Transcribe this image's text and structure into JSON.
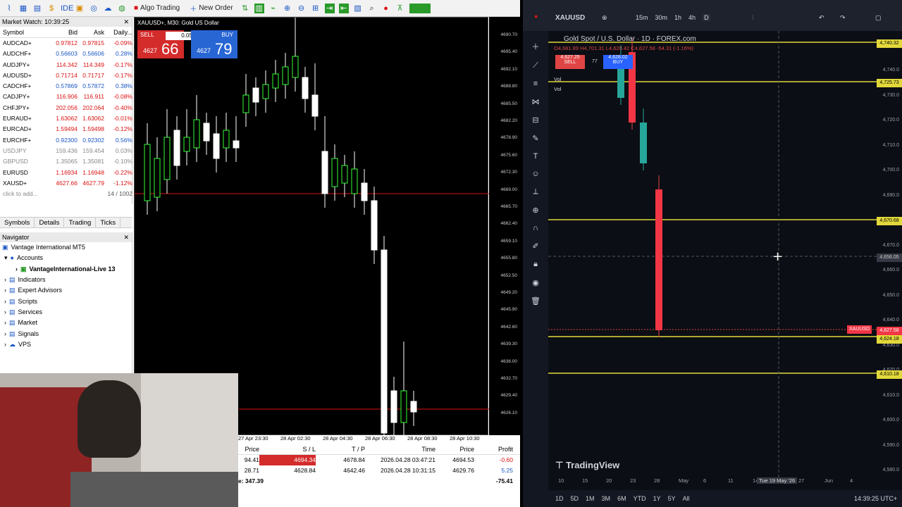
{
  "toolbar": {
    "algo_trading": "Algo Trading",
    "new_order": "New Order"
  },
  "market_watch": {
    "title": "Market Watch: 10:39:25",
    "headers": [
      "Symbol",
      "Bid",
      "Ask",
      "Daily..."
    ],
    "rows": [
      [
        "AUDCAD+",
        "0.97812",
        "0.97815",
        "-0.09%"
      ],
      [
        "AUDCHF+",
        "0.56603",
        "0.56606",
        "0.28%"
      ],
      [
        "AUDJPY+",
        "114.342",
        "114.349",
        "-0.17%"
      ],
      [
        "AUDUSD+",
        "0.71714",
        "0.71717",
        "-0.17%"
      ],
      [
        "CADCHF+",
        "0.57869",
        "0.57872",
        "0.38%"
      ],
      [
        "CADJPY+",
        "116.906",
        "116.911",
        "-0.08%"
      ],
      [
        "CHFJPY+",
        "202.056",
        "202.064",
        "-0.40%"
      ],
      [
        "EURAUD+",
        "1.63062",
        "1.63062",
        "-0.01%"
      ],
      [
        "EURCAD+",
        "1.59494",
        "1.59498",
        "-0.12%"
      ],
      [
        "EURCHF+",
        "0.92300",
        "0.92302",
        "0.56%"
      ],
      [
        "USDJPY",
        "159.436",
        "159.454",
        "0.03%"
      ],
      [
        "GBPUSD",
        "1.35065",
        "1.35081",
        "-0.10%"
      ],
      [
        "EURUSD",
        "1.16934",
        "1.16948",
        "-0.22%"
      ],
      [
        "XAUSD+",
        "4627.66",
        "4627.79",
        "-1.12%"
      ]
    ],
    "add_hint": "click to add...",
    "count": "14 / 1002",
    "tabs": [
      "Symbols",
      "Details",
      "Trading",
      "Ticks"
    ]
  },
  "navigator": {
    "title": "Navigator",
    "items": [
      "Vantage International MT5",
      "Accounts",
      "VantageInternational-Live 13",
      "Indicators",
      "Expert Advisors",
      "Scripts",
      "Services",
      "Market",
      "Signals",
      "VPS"
    ]
  },
  "chart": {
    "title": "XAUUSD+, M30: Gold US Dollar",
    "sell_label": "SELL",
    "buy_label": "BUY",
    "lot": "0.05",
    "sell_price_small": "4627",
    "sell_price_big": "66",
    "buy_price_small": "4627",
    "buy_price_big": "79",
    "yticks": [
      "4690.70",
      "4695.40",
      "4692.10",
      "4688.80",
      "4685.50",
      "4682.20",
      "4678.90",
      "4675.60",
      "4672.30",
      "4669.00",
      "4665.70",
      "4662.40",
      "4659.10",
      "4655.80",
      "4652.50",
      "4649.20",
      "4645.90",
      "4642.60",
      "4639.30",
      "4636.00",
      "4632.70",
      "4629.40",
      "4626.10"
    ],
    "xticks": [
      "27 Apr 23:30",
      "28 Apr 02:30",
      "28 Apr 04:30",
      "28 Apr 06:30",
      "28 Apr 08:30",
      "28 Apr 10:30"
    ]
  },
  "orders": {
    "headers": [
      "Price",
      "S / L",
      "T / P",
      "Time",
      "Price",
      "Profit"
    ],
    "rows": [
      [
        "94.41",
        "4694.34",
        "4678.84",
        "2026.04.28 03:47:21",
        "4694.53",
        "-0.60"
      ],
      [
        "28.71",
        "4628.84",
        "4642.46",
        "2026.04.28 10:31:15",
        "4629.76",
        "5.25"
      ]
    ],
    "balance": "e: 347.39",
    "total": "-75.41"
  },
  "tradingview": {
    "symbol": "XAUUSD",
    "timeframes": [
      "15m",
      "30m",
      "1h",
      "4h",
      "D"
    ],
    "title": "Gold Spot / U.S. Dollar · 1D · FOREX.com",
    "ohlc": "O4,681.89 H4,701.31 L4,620.42 C4,627.58 -54.31 (-1.16%)",
    "sell_price": "4,627.25",
    "sell_label": "SELL",
    "buy_price": "4,628.02",
    "buy_label": "BUY",
    "spread": "77",
    "vol": "Vol",
    "brand": "TradingView",
    "yticks": [
      "4,740.0",
      "4,730.0",
      "4,720.0",
      "4,710.0",
      "4,700.0",
      "4,690.0",
      "4,680.0",
      "4,670.0",
      "4,660.0",
      "4,650.0",
      "4,640.0",
      "4,630.0",
      "4,620.0",
      "4,610.0",
      "4,600.0",
      "4,590.0",
      "4,580.0"
    ],
    "level_labels": [
      "4,740.32",
      "4,725.73",
      "4,670.68",
      "4,656.05",
      "4,627.58",
      "4,624.18",
      "4,610.18"
    ],
    "price_tag": "XAUUSD",
    "xticks": [
      "10",
      "15",
      "20",
      "23",
      "28",
      "May",
      "6",
      "11",
      "14",
      "27",
      "Jun",
      "4"
    ],
    "cursor_date": "Tue 19 May '26",
    "ranges": [
      "1D",
      "5D",
      "1M",
      "3M",
      "6M",
      "YTD",
      "1Y",
      "5Y",
      "All"
    ],
    "clock": "14:39:25 UTC+"
  }
}
